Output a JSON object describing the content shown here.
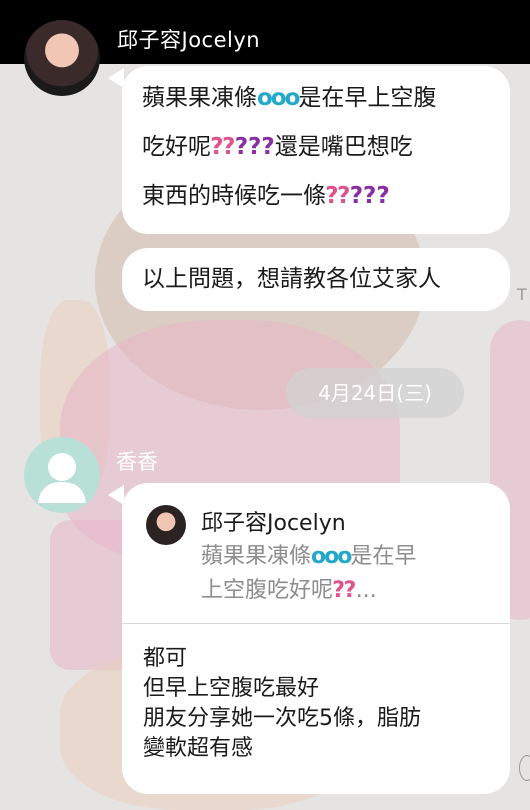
{
  "top": {
    "sender_name": "邱子容Jocelyn"
  },
  "messages": [
    {
      "lines": [
        {
          "parts": [
            {
              "t": "蘋果果凍條"
            },
            {
              "t": "ooo",
              "c": "emoji-ooo"
            },
            {
              "t": "是在早上空腹"
            }
          ]
        },
        {
          "parts": [
            {
              "t": "吃好呢"
            },
            {
              "t": "⁇",
              "c": "emoji-q"
            },
            {
              "t": "???",
              "c": "emoji-q2"
            },
            {
              "t": "還是嘴巴想吃"
            }
          ]
        },
        {
          "parts": [
            {
              "t": "東西的時候吃一條"
            },
            {
              "t": "⁇",
              "c": "emoji-q"
            },
            {
              "t": "???",
              "c": "emoji-q2"
            }
          ]
        }
      ]
    },
    {
      "lines": [
        {
          "parts": [
            {
              "t": "以上問題，想請教各位艾家人"
            }
          ]
        }
      ]
    }
  ],
  "date_divider": "4月24日(三)",
  "reply": {
    "friend_name": "香香",
    "quote": {
      "name": "邱子容Jocelyn",
      "line1": "蘋果果凍條",
      "line1_emoji": "ooo",
      "line1_rest": "是在早",
      "line2": "上空腹吃好呢",
      "line2_emoji": "⁇",
      "line2_rest": "..."
    },
    "text_lines": [
      "都可",
      "但早上空腹吃最好",
      "朋友分享她一次吃5條，脂肪",
      "變軟超有感"
    ]
  },
  "side_marks": {
    "tick": "T"
  },
  "colors": {
    "topbar": "#000000",
    "bubble": "#ffffff",
    "default_avatar": "#b9e0d6"
  },
  "icons": [
    "user-avatar-photo",
    "default-avatar-icon"
  ]
}
